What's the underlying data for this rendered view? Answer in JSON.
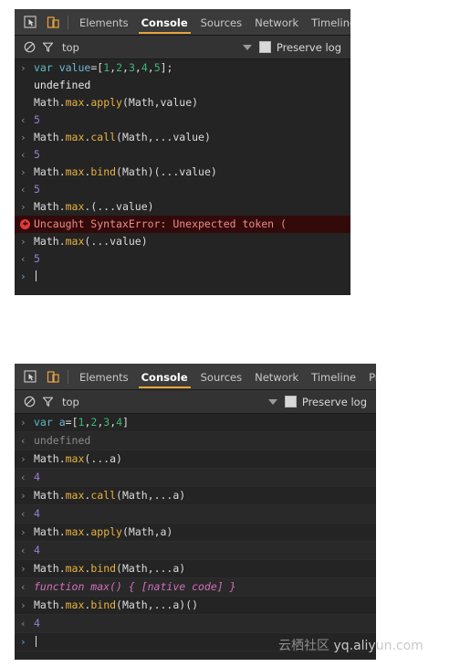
{
  "panels": [
    {
      "id": "panel-one",
      "toolbar": {
        "inspect_icon": "inspect-cursor-icon",
        "device_icon": "device-toolbar-icon",
        "tabs": [
          {
            "label": "Elements",
            "active": false
          },
          {
            "label": "Console",
            "active": true
          },
          {
            "label": "Sources",
            "active": false
          },
          {
            "label": "Network",
            "active": false
          },
          {
            "label": "Timeline",
            "active": false
          }
        ]
      },
      "filterbar": {
        "clear_icon": "clear-console-icon",
        "filter_icon": "filter-funnel-icon",
        "context": "top",
        "caret_icon": "chevron-down-icon",
        "preserve_log_label": "Preserve log",
        "preserve_log_checked": false
      },
      "rows": [
        {
          "kind": "input",
          "gutter": "›",
          "tokens": [
            {
              "t": "var ",
              "c": "t-kw"
            },
            {
              "t": "value",
              "c": "t-var"
            },
            {
              "t": "=[",
              "c": "t-punct"
            },
            {
              "t": "1",
              "c": "t-num"
            },
            {
              "t": ",",
              "c": "t-punct"
            },
            {
              "t": "2",
              "c": "t-num"
            },
            {
              "t": ",",
              "c": "t-punct"
            },
            {
              "t": "3",
              "c": "t-num"
            },
            {
              "t": ",",
              "c": "t-punct"
            },
            {
              "t": "4",
              "c": "t-num"
            },
            {
              "t": ",",
              "c": "t-punct"
            },
            {
              "t": "5",
              "c": "t-num"
            },
            {
              "t": "];",
              "c": "t-punct"
            }
          ]
        },
        {
          "kind": "cont",
          "gutter": "",
          "tokens": [
            {
              "t": "undefined",
              "c": "t-undef-bright"
            }
          ]
        },
        {
          "kind": "cont",
          "gutter": "",
          "tokens": [
            {
              "t": "Math.",
              "c": "t-plain"
            },
            {
              "t": "max",
              "c": "t-prop"
            },
            {
              "t": ".",
              "c": "t-plain"
            },
            {
              "t": "apply",
              "c": "t-prop"
            },
            {
              "t": "(Math,value)",
              "c": "t-plain"
            }
          ]
        },
        {
          "kind": "output",
          "gutter": "‹",
          "tokens": [
            {
              "t": "5",
              "c": "t-result"
            }
          ]
        },
        {
          "kind": "input",
          "gutter": "›",
          "tokens": [
            {
              "t": "Math.",
              "c": "t-plain"
            },
            {
              "t": "max",
              "c": "t-prop"
            },
            {
              "t": ".",
              "c": "t-plain"
            },
            {
              "t": "call",
              "c": "t-prop"
            },
            {
              "t": "(Math,...value)",
              "c": "t-plain"
            }
          ]
        },
        {
          "kind": "output",
          "gutter": "‹",
          "tokens": [
            {
              "t": "5",
              "c": "t-result"
            }
          ]
        },
        {
          "kind": "input",
          "gutter": "›",
          "tokens": [
            {
              "t": "Math.",
              "c": "t-plain"
            },
            {
              "t": "max",
              "c": "t-prop"
            },
            {
              "t": ".",
              "c": "t-plain"
            },
            {
              "t": "bind",
              "c": "t-prop"
            },
            {
              "t": "(Math)(...value)",
              "c": "t-plain"
            }
          ]
        },
        {
          "kind": "output",
          "gutter": "‹",
          "tokens": [
            {
              "t": "5",
              "c": "t-result"
            }
          ]
        },
        {
          "kind": "input",
          "gutter": "›",
          "tokens": [
            {
              "t": "Math.",
              "c": "t-plain"
            },
            {
              "t": "max",
              "c": "t-prop"
            },
            {
              "t": ".(...value)",
              "c": "t-plain"
            }
          ]
        },
        {
          "kind": "error",
          "gutter": "",
          "error_text": "Uncaught SyntaxError: Unexpected token ("
        },
        {
          "kind": "input",
          "gutter": "›",
          "tokens": [
            {
              "t": "Math.",
              "c": "t-plain"
            },
            {
              "t": "max",
              "c": "t-prop"
            },
            {
              "t": "(...value)",
              "c": "t-plain"
            }
          ]
        },
        {
          "kind": "output",
          "gutter": "‹",
          "tokens": [
            {
              "t": "5",
              "c": "t-result"
            }
          ]
        },
        {
          "kind": "prompt",
          "gutter": "›",
          "tokens": []
        }
      ]
    },
    {
      "id": "panel-two",
      "toolbar": {
        "inspect_icon": "inspect-cursor-icon",
        "device_icon": "device-toolbar-icon",
        "tabs": [
          {
            "label": "Elements",
            "active": false
          },
          {
            "label": "Console",
            "active": true
          },
          {
            "label": "Sources",
            "active": false
          },
          {
            "label": "Network",
            "active": false
          },
          {
            "label": "Timeline",
            "active": false
          },
          {
            "label": "Pro",
            "active": false
          }
        ]
      },
      "filterbar": {
        "clear_icon": "clear-console-icon",
        "filter_icon": "filter-funnel-icon",
        "context": "top",
        "caret_icon": "chevron-down-icon",
        "preserve_log_label": "Preserve log",
        "preserve_log_checked": false
      },
      "rows": [
        {
          "kind": "input",
          "gutter": "›",
          "tokens": [
            {
              "t": "var ",
              "c": "t-kw"
            },
            {
              "t": "a",
              "c": "t-var"
            },
            {
              "t": "=[",
              "c": "t-punct"
            },
            {
              "t": "1",
              "c": "t-num"
            },
            {
              "t": ",",
              "c": "t-punct"
            },
            {
              "t": "2",
              "c": "t-num"
            },
            {
              "t": ",",
              "c": "t-punct"
            },
            {
              "t": "3",
              "c": "t-num"
            },
            {
              "t": ",",
              "c": "t-punct"
            },
            {
              "t": "4",
              "c": "t-num"
            },
            {
              "t": "]",
              "c": "t-punct"
            }
          ]
        },
        {
          "kind": "output",
          "gutter": "‹",
          "zebra": true,
          "tokens": [
            {
              "t": "undefined",
              "c": "t-undef-dim"
            }
          ]
        },
        {
          "kind": "input",
          "gutter": "›",
          "tokens": [
            {
              "t": "Math.",
              "c": "t-plain"
            },
            {
              "t": "max",
              "c": "t-prop"
            },
            {
              "t": "(...a)",
              "c": "t-plain"
            }
          ]
        },
        {
          "kind": "output",
          "gutter": "‹",
          "zebra": true,
          "tokens": [
            {
              "t": "4",
              "c": "t-result"
            }
          ]
        },
        {
          "kind": "input",
          "gutter": "›",
          "tokens": [
            {
              "t": "Math.",
              "c": "t-plain"
            },
            {
              "t": "max",
              "c": "t-prop"
            },
            {
              "t": ".",
              "c": "t-plain"
            },
            {
              "t": "call",
              "c": "t-prop"
            },
            {
              "t": "(Math,...a)",
              "c": "t-plain"
            }
          ]
        },
        {
          "kind": "output",
          "gutter": "‹",
          "zebra": true,
          "tokens": [
            {
              "t": "4",
              "c": "t-result"
            }
          ]
        },
        {
          "kind": "input",
          "gutter": "›",
          "tokens": [
            {
              "t": "Math.",
              "c": "t-plain"
            },
            {
              "t": "max",
              "c": "t-prop"
            },
            {
              "t": ".",
              "c": "t-plain"
            },
            {
              "t": "apply",
              "c": "t-prop"
            },
            {
              "t": "(Math,a)",
              "c": "t-plain"
            }
          ]
        },
        {
          "kind": "output",
          "gutter": "‹",
          "zebra": true,
          "tokens": [
            {
              "t": "4",
              "c": "t-result"
            }
          ]
        },
        {
          "kind": "input",
          "gutter": "›",
          "tokens": [
            {
              "t": "Math.",
              "c": "t-plain"
            },
            {
              "t": "max",
              "c": "t-prop"
            },
            {
              "t": ".",
              "c": "t-plain"
            },
            {
              "t": "bind",
              "c": "t-prop"
            },
            {
              "t": "(Math,...a)",
              "c": "t-plain"
            }
          ]
        },
        {
          "kind": "output",
          "gutter": "‹",
          "zebra": true,
          "tokens": [
            {
              "t": "function max() { [native code] }",
              "c": "t-fn"
            }
          ]
        },
        {
          "kind": "input",
          "gutter": "›",
          "tokens": [
            {
              "t": "Math.",
              "c": "t-plain"
            },
            {
              "t": "max",
              "c": "t-prop"
            },
            {
              "t": ".",
              "c": "t-plain"
            },
            {
              "t": "bind",
              "c": "t-prop"
            },
            {
              "t": "(Math,...a)()",
              "c": "t-plain"
            }
          ]
        },
        {
          "kind": "output",
          "gutter": "‹",
          "zebra": true,
          "tokens": [
            {
              "t": "4",
              "c": "t-result"
            }
          ]
        },
        {
          "kind": "prompt",
          "gutter": "›",
          "tokens": []
        }
      ]
    }
  ],
  "watermark": {
    "cn": "云栖社区",
    "en": "yq.aliyun.com"
  },
  "colors": {
    "accent_tab": "#e8a33d",
    "panel_bg": "#242424",
    "toolbar_bg": "#3b3b3b",
    "filterbar_bg": "#333333",
    "error_bg": "#330a0a",
    "error_text": "#f08a8a",
    "result_value": "#9a7fd4",
    "property": "#e8b33d",
    "keyword": "#5fb8c0",
    "number": "#3cb878",
    "function_literal": "#d36fbb",
    "prompt_arrow": "#4a90d9"
  }
}
